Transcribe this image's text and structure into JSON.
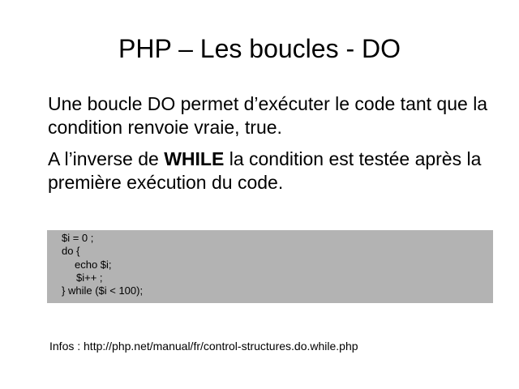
{
  "slide": {
    "title": "PHP – Les boucles - DO",
    "paragraph1": "Une boucle DO permet d’exécuter le code tant que la condition renvoie vraie, true.",
    "paragraph2": {
      "before": "A l’inverse de ",
      "keyword": "WHILE",
      "after": " la condition est testée après la première exécution du code."
    },
    "code_lines": [
      "$i = 0 ;",
      "do {",
      "echo $i;",
      "$i++ ;",
      "} while ($i < 100);"
    ],
    "code_background": "#b3b3b3",
    "infos": "Infos : http://php.net/manual/fr/control-structures.do.while.php"
  }
}
